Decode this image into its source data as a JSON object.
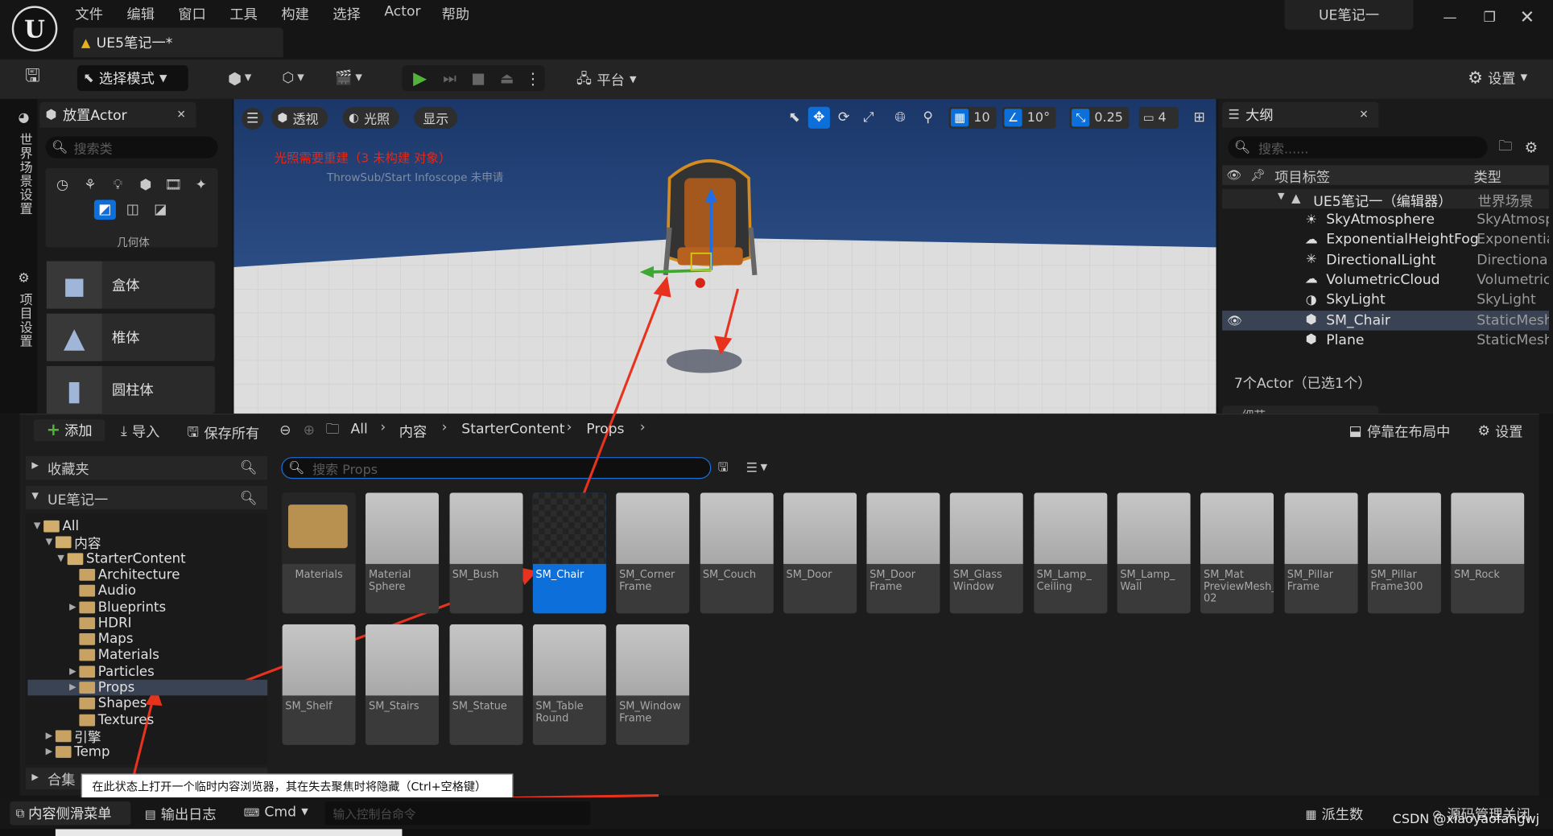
{
  "app": {
    "title": "UE笔记一",
    "tab": "UE5笔记一*",
    "menu": [
      "文件",
      "编辑",
      "窗口",
      "工具",
      "构建",
      "选择",
      "Actor",
      "帮助"
    ]
  },
  "toolbar": {
    "select_mode": "选择模式",
    "platform": "平台",
    "settings": "设置"
  },
  "left_strip": {
    "world_settings": "世界场景设置",
    "project_settings": "项目设置"
  },
  "place_actor": {
    "title": "放置Actor",
    "search_placeholder": "搜索类",
    "category": "几何体",
    "items": [
      "盒体",
      "椎体",
      "圆柱体"
    ]
  },
  "viewport": {
    "menu": [
      "透视",
      "光照",
      "显示"
    ],
    "grid_snap": "10",
    "rot_snap": "10°",
    "scale_snap": "0.25",
    "cam_speed": "4",
    "warning": "光照需要重建（3 未构建 对象）",
    "warning_sub": "ThrowSub/Start Infoscope 未申请"
  },
  "outliner": {
    "title": "大纲",
    "search_placeholder": "搜索......",
    "col_label": "项目标签",
    "col_type": "类型",
    "root": {
      "name": "UE5笔记一（编辑器）",
      "type": "世界场景"
    },
    "rows": [
      {
        "name": "SkyAtmosphere",
        "type": "SkyAtmosp",
        "icon": "sun-icon"
      },
      {
        "name": "ExponentialHeightFog",
        "type": "Exponential",
        "icon": "fog-icon"
      },
      {
        "name": "DirectionalLight",
        "type": "DirectionalL",
        "icon": "light-icon"
      },
      {
        "name": "VolumetricCloud",
        "type": "Volumetric(",
        "icon": "cloud-icon"
      },
      {
        "name": "SkyLight",
        "type": "SkyLight",
        "icon": "skylight-icon"
      },
      {
        "name": "SM_Chair",
        "type": "StaticMesh.",
        "icon": "mesh-icon",
        "selected": true
      },
      {
        "name": "Plane",
        "type": "StaticMesh.",
        "icon": "mesh-icon"
      }
    ],
    "status": "7个Actor（已选1个）",
    "details": "细节"
  },
  "content_browser": {
    "add": "添加",
    "import": "导入",
    "save_all": "保存所有",
    "path": [
      "All",
      "内容",
      "StarterContent",
      "Props"
    ],
    "dock": "停靠在布局中",
    "settings": "设置",
    "favorites": "收藏夹",
    "project": "UE笔记一",
    "search_placeholder": "搜索 Props",
    "tree": [
      {
        "label": "All",
        "depth": 0,
        "arrow": "▼"
      },
      {
        "label": "内容",
        "depth": 1,
        "arrow": "▼"
      },
      {
        "label": "StarterContent",
        "depth": 2,
        "arrow": "▼"
      },
      {
        "label": "Architecture",
        "depth": 3,
        "arrow": ""
      },
      {
        "label": "Audio",
        "depth": 3,
        "arrow": ""
      },
      {
        "label": "Blueprints",
        "depth": 3,
        "arrow": "▶"
      },
      {
        "label": "HDRI",
        "depth": 3,
        "arrow": ""
      },
      {
        "label": "Maps",
        "depth": 3,
        "arrow": ""
      },
      {
        "label": "Materials",
        "depth": 3,
        "arrow": ""
      },
      {
        "label": "Particles",
        "depth": 3,
        "arrow": "▶"
      },
      {
        "label": "Props",
        "depth": 3,
        "arrow": "▶",
        "selected": true
      },
      {
        "label": "Shapes",
        "depth": 3,
        "arrow": ""
      },
      {
        "label": "Textures",
        "depth": 3,
        "arrow": ""
      },
      {
        "label": "引擎",
        "depth": 1,
        "arrow": "▶"
      },
      {
        "label": "Temp",
        "depth": 1,
        "arrow": "▶"
      }
    ],
    "collections": "合集",
    "assets": [
      "Materials",
      "Material\nSphere",
      "SM_Bush",
      "SM_Chair",
      "SM_Corner\nFrame",
      "SM_Couch",
      "SM_Door",
      "SM_Door\nFrame",
      "SM_Glass\nWindow",
      "SM_Lamp_\nCeiling",
      "SM_Lamp_\nWall",
      "SM_Mat\nPreviewMesh_\n02",
      "SM_Pillar\nFrame",
      "SM_Pillar\nFrame300",
      "SM_Rock",
      "SM_Shelf",
      "SM_Stairs",
      "SM_Statue",
      "SM_Table\nRound",
      "SM_Window\nFrame"
    ]
  },
  "tooltip": "在此状态上打开一个临时内容浏览器，其在失去聚焦时将隐藏（Ctrl+空格键）",
  "bottom": {
    "drawer": "内容侧滑菜单",
    "output_log": "输出日志",
    "cmd": "Cmd",
    "console_placeholder": "输入控制台命令",
    "derived": "派生数",
    "source_control": "源码管理关闭"
  },
  "watermark": "CSDN @xiaoyaofangwj",
  "colors": {
    "accent": "#0d6fd9",
    "play": "#52b33a",
    "warning": "#e02a1a",
    "arrow": "#e8321e"
  }
}
